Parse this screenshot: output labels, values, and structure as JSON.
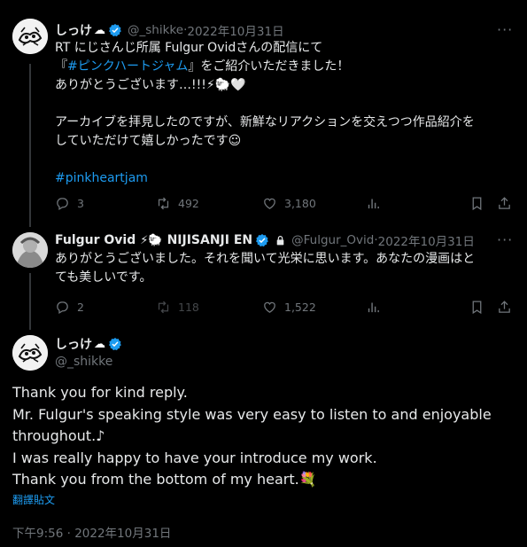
{
  "tweet1": {
    "name": "しっけ",
    "name_emoji": "☁",
    "handle": "@_shikke",
    "date": "2022年10月31日",
    "lines": [
      "RT にじさんじ所属 Fulgur Ovidさんの配信にて"
    ],
    "line2_pre": "『",
    "line2_link": "#ピンクハートジャム",
    "line2_post": "』をご紹介いただきました！",
    "line3": "ありがとうございます…!!!⚡🐑🤍",
    "line4": "アーカイブを拝見したのですが、新鮮なリアクションを交えつつ作品紹介を",
    "line5": "していただけて嬉しかったです☺",
    "hashtag": "#pinkheartjam",
    "replies": "3",
    "retweets": "492",
    "likes": "3,180"
  },
  "tweet2": {
    "name": "Fulgur Ovid",
    "name_emoji": "⚡🐑",
    "org": "NIJISANJI EN",
    "handle": "@Fulgur_Ovid",
    "date": "2022年10月31日",
    "line1": "ありがとうございました。それを聞いて光栄に思います。あなたの漫画はと",
    "line2": "ても美しいです。",
    "replies": "2",
    "retweets": "118",
    "likes": "1,522"
  },
  "tweet3": {
    "name": "しっけ",
    "name_emoji": "☁",
    "handle": "@_shikke",
    "lines": [
      "Thank you for kind reply.",
      "Mr. Fulgur's speaking style was very easy to listen to and enjoyable",
      "throughout.♪",
      "I was really happy to have your introduce my work.",
      "Thank you from the bottom of my heart.💐"
    ],
    "translate": "翻譯貼文",
    "timestamp": "下午9:56 · 2022年10月31日"
  },
  "separator": " · ",
  "colors": {
    "background": "#000000",
    "text": "#e7e9ea",
    "muted": "#71767b",
    "link": "#1d9bf0",
    "verified": "#1d9bf0"
  },
  "icons": [
    "more-icon",
    "reply-icon",
    "retweet-icon",
    "like-icon",
    "views-icon",
    "bookmark-icon",
    "share-icon",
    "verified-icon",
    "lock-icon"
  ]
}
